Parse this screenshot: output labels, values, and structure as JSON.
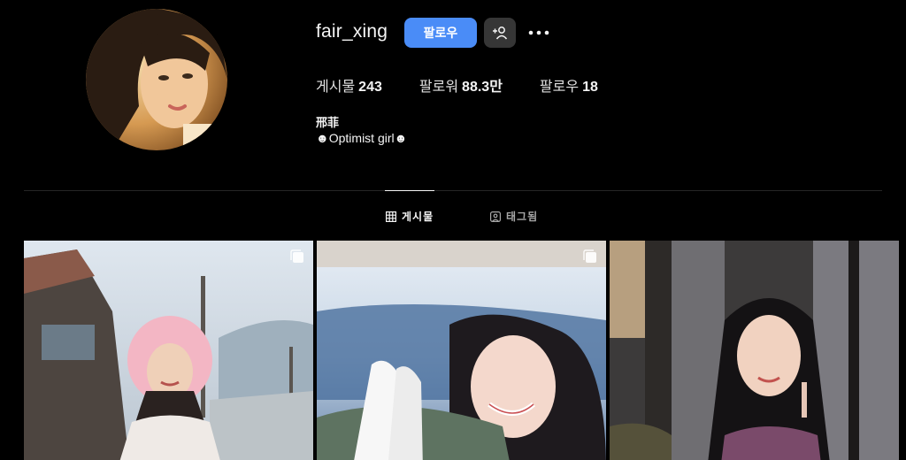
{
  "profile": {
    "username": "fair_xing",
    "display_name": "邢菲",
    "bio": "☻Optimist girl☻"
  },
  "actions": {
    "follow_label": "팔로우",
    "suggest_icon": "person-plus-icon",
    "more_icon": "more-dots-icon"
  },
  "stats": [
    {
      "label": "게시물",
      "value": "243"
    },
    {
      "label": "팔로워",
      "value": "88.3만"
    },
    {
      "label": "팔로우",
      "value": "18"
    }
  ],
  "tabs": [
    {
      "label": "게시물",
      "icon": "grid-icon",
      "active": true
    },
    {
      "label": "태그됨",
      "icon": "tagged-icon",
      "active": false
    }
  ],
  "posts": [
    {
      "multi": true
    },
    {
      "multi": true
    },
    {
      "multi": false
    }
  ],
  "colors": {
    "background": "#000000",
    "accent": "#4a8cf7",
    "secondary_button": "#363636"
  }
}
